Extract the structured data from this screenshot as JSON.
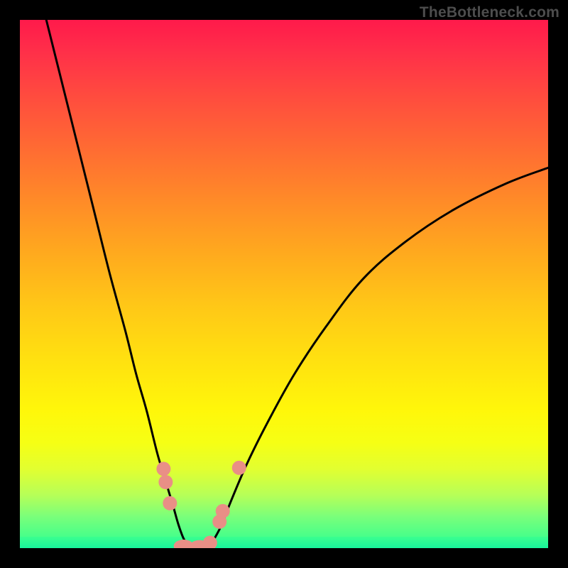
{
  "watermark": "TheBottleneck.com",
  "colors": {
    "frame": "#000000",
    "curve": "#000000",
    "marker": "#e98f86",
    "gradient_top": "#ff1a4b",
    "gradient_bottom": "#18f59c"
  },
  "chart_data": {
    "type": "line",
    "title": "",
    "xlabel": "",
    "ylabel": "",
    "xlim": [
      0,
      100
    ],
    "ylim": [
      0,
      100
    ],
    "series": [
      {
        "name": "left-branch",
        "x": [
          5,
          8,
          11,
          14,
          17,
          20,
          22,
          24,
          26,
          27.5,
          29,
          30,
          31,
          32
        ],
        "y": [
          100,
          88,
          76,
          64,
          52,
          41,
          33,
          26,
          18,
          13,
          8,
          4.5,
          1.8,
          0.4
        ]
      },
      {
        "name": "right-branch",
        "x": [
          36,
          38,
          40,
          43,
          47,
          52,
          58,
          65,
          73,
          82,
          92,
          100
        ],
        "y": [
          0.4,
          4,
          9,
          16,
          24,
          33,
          42,
          51,
          58,
          64,
          69,
          72
        ]
      }
    ],
    "markers": [
      {
        "x": 27.2,
        "y": 15,
        "shape": "dot"
      },
      {
        "x": 27.6,
        "y": 12.5,
        "shape": "dot"
      },
      {
        "x": 28.4,
        "y": 8.5,
        "shape": "dot"
      },
      {
        "x": 31.0,
        "y": 0.4,
        "shape": "oblong"
      },
      {
        "x": 34.0,
        "y": 0.3,
        "shape": "oblong"
      },
      {
        "x": 36.0,
        "y": 1.0,
        "shape": "dot"
      },
      {
        "x": 37.8,
        "y": 5.0,
        "shape": "dot"
      },
      {
        "x": 38.4,
        "y": 7.0,
        "shape": "dot"
      },
      {
        "x": 41.5,
        "y": 15.2,
        "shape": "dot"
      }
    ]
  }
}
